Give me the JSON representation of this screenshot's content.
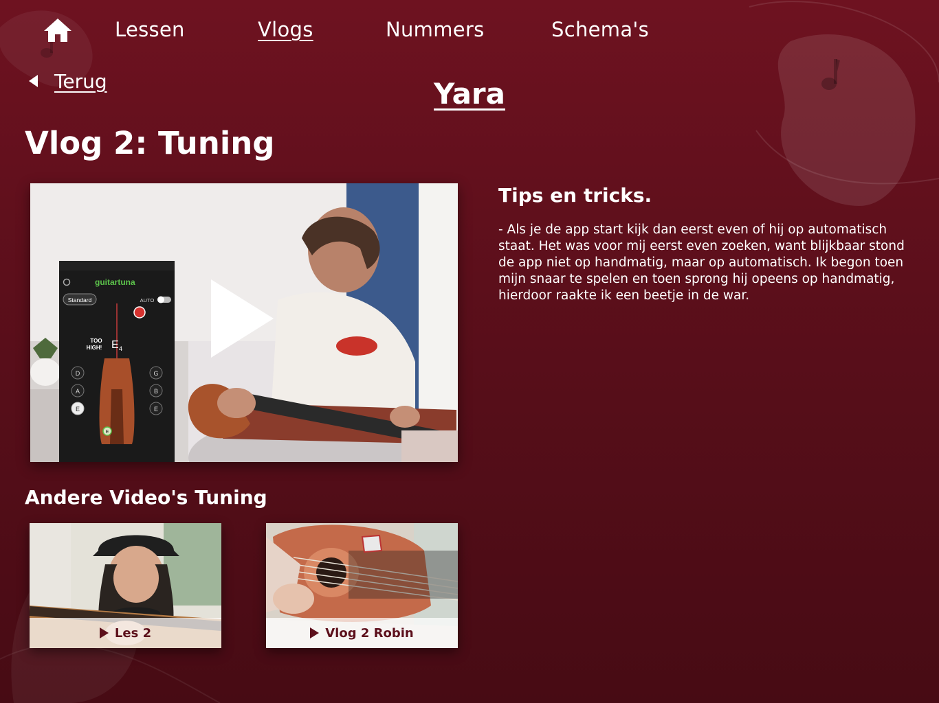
{
  "nav": {
    "items": [
      {
        "label": "Lessen"
      },
      {
        "label": "Vlogs"
      },
      {
        "label": "Nummers"
      },
      {
        "label": "Schema's"
      }
    ]
  },
  "back_label": "Terug",
  "author": "Yara",
  "page_title": "Vlog 2: Tuning",
  "video": {
    "app_name": "guitartuna",
    "mode": "Standard",
    "auto_label": "AUTO",
    "note": "E",
    "note_octave": "4",
    "status_line1": "TOO",
    "status_line2": "HIGH!",
    "strings_left": [
      "D",
      "A",
      "E"
    ],
    "strings_right": [
      "G",
      "B",
      "E"
    ],
    "marker": "E"
  },
  "tips": {
    "title": "Tips en tricks.",
    "body": "- Als je de app start kijk dan eerst even of hij op automatisch staat. Het was voor mij eerst even zoeken, want blijkbaar stond de app niet op handmatig, maar op automatisch. Ik begon toen mijn snaar te spelen en toen sprong hij opeens op handmatig, hierdoor raakte ik een beetje in de war."
  },
  "more": {
    "title": "Andere Video's Tuning",
    "items": [
      {
        "label": "Les 2"
      },
      {
        "label": "Vlog 2 Robin"
      }
    ]
  },
  "colors": {
    "background": "#5c0f1b",
    "accent_text": "#5c0f1b"
  }
}
